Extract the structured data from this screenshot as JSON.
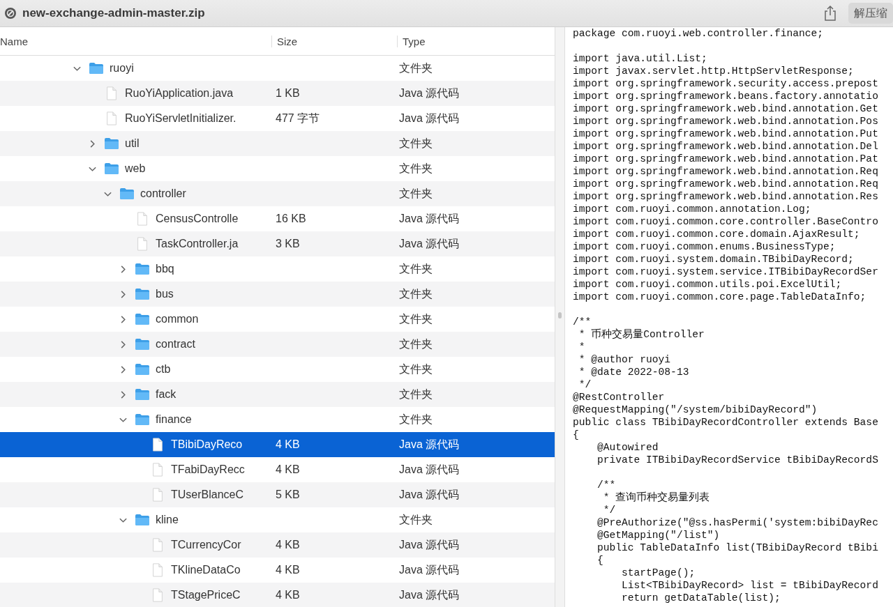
{
  "window": {
    "title": "new-exchange-admin-master.zip"
  },
  "toolbar": {
    "extract_button": "解压缩"
  },
  "columns": [
    "Name",
    "Size",
    "Type"
  ],
  "files": [
    {
      "kind": "folder",
      "name": "ruoyi",
      "type": "文件夹",
      "expanded": true,
      "selected": false,
      "children": [
        {
          "kind": "file",
          "name": "RuoYiApplication.java",
          "size": "1 KB",
          "type": "Java 源代码",
          "selected": false
        },
        {
          "kind": "file",
          "name": "RuoYiServletInitializer.",
          "size": "477 字节",
          "type": "Java 源代码",
          "selected": false
        },
        {
          "kind": "folder",
          "name": "util",
          "type": "文件夹",
          "expanded": false,
          "selected": false
        },
        {
          "kind": "folder",
          "name": "web",
          "type": "文件夹",
          "expanded": true,
          "selected": false,
          "children": [
            {
              "kind": "folder",
              "name": "controller",
              "type": "文件夹",
              "expanded": true,
              "selected": false,
              "children": [
                {
                  "kind": "file",
                  "name": "CensusControlle",
                  "size": "16 KB",
                  "type": "Java 源代码",
                  "selected": false
                },
                {
                  "kind": "file",
                  "name": "TaskController.ja",
                  "size": "3 KB",
                  "type": "Java 源代码",
                  "selected": false
                },
                {
                  "kind": "folder",
                  "name": "bbq",
                  "type": "文件夹",
                  "expanded": false,
                  "selected": false
                },
                {
                  "kind": "folder",
                  "name": "bus",
                  "type": "文件夹",
                  "expanded": false,
                  "selected": false
                },
                {
                  "kind": "folder",
                  "name": "common",
                  "type": "文件夹",
                  "expanded": false,
                  "selected": false
                },
                {
                  "kind": "folder",
                  "name": "contract",
                  "type": "文件夹",
                  "expanded": false,
                  "selected": false
                },
                {
                  "kind": "folder",
                  "name": "ctb",
                  "type": "文件夹",
                  "expanded": false,
                  "selected": false
                },
                {
                  "kind": "folder",
                  "name": "fack",
                  "type": "文件夹",
                  "expanded": false,
                  "selected": false
                },
                {
                  "kind": "folder",
                  "name": "finance",
                  "type": "文件夹",
                  "expanded": true,
                  "selected": false,
                  "children": [
                    {
                      "kind": "file",
                      "name": "TBibiDayReco",
                      "size": "4 KB",
                      "type": "Java 源代码",
                      "selected": true
                    },
                    {
                      "kind": "file",
                      "name": "TFabiDayRecc",
                      "size": "4 KB",
                      "type": "Java 源代码",
                      "selected": false
                    },
                    {
                      "kind": "file",
                      "name": "TUserBlanceC",
                      "size": "5 KB",
                      "type": "Java 源代码",
                      "selected": false
                    }
                  ]
                },
                {
                  "kind": "folder",
                  "name": "kline",
                  "type": "文件夹",
                  "expanded": true,
                  "selected": false,
                  "children": [
                    {
                      "kind": "file",
                      "name": "TCurrencyCor",
                      "size": "4 KB",
                      "type": "Java 源代码",
                      "selected": false
                    },
                    {
                      "kind": "file",
                      "name": "TKlineDataCo",
                      "size": "4 KB",
                      "type": "Java 源代码",
                      "selected": false
                    },
                    {
                      "kind": "file",
                      "name": "TStagePriceC",
                      "size": "4 KB",
                      "type": "Java 源代码",
                      "selected": false
                    }
                  ]
                }
              ]
            }
          ]
        }
      ]
    }
  ],
  "code": {
    "blocks": [
      [
        "package com.ruoyi.web.controller.finance;"
      ],
      [
        "import java.util.List;",
        "import javax.servlet.http.HttpServletResponse;",
        "import org.springframework.security.access.prepost",
        "import org.springframework.beans.factory.annotatio",
        "import org.springframework.web.bind.annotation.Get",
        "import org.springframework.web.bind.annotation.Pos",
        "import org.springframework.web.bind.annotation.Put",
        "import org.springframework.web.bind.annotation.Del",
        "import org.springframework.web.bind.annotation.Pat",
        "import org.springframework.web.bind.annotation.Req",
        "import org.springframework.web.bind.annotation.Req",
        "import org.springframework.web.bind.annotation.Res",
        "import com.ruoyi.common.annotation.Log;",
        "import com.ruoyi.common.core.controller.BaseContro",
        "import com.ruoyi.common.core.domain.AjaxResult;",
        "import com.ruoyi.common.enums.BusinessType;",
        "import com.ruoyi.system.domain.TBibiDayRecord;",
        "import com.ruoyi.system.service.ITBibiDayRecordSer",
        "import com.ruoyi.common.utils.poi.ExcelUtil;",
        "import com.ruoyi.common.core.page.TableDataInfo;"
      ],
      [
        "/**",
        " * 币种交易量Controller",
        " *",
        " * @author ruoyi",
        " * @date 2022-08-13",
        " */",
        "@RestController",
        "@RequestMapping(\"/system/bibiDayRecord\")",
        "public class TBibiDayRecordController extends Base",
        "{",
        "    @Autowired",
        "    private ITBibiDayRecordService tBibiDayRecordS"
      ],
      [
        "    /**",
        "     * 查询币种交易量列表",
        "     */",
        "    @PreAuthorize(\"@ss.hasPermi('system:bibiDayRec",
        "    @GetMapping(\"/list\")",
        "    public TableDataInfo list(TBibiDayRecord tBibi",
        "    {",
        "        startPage();",
        "        List<TBibiDayRecord> list = tBibiDayRecord",
        "        return getDataTable(list);"
      ]
    ]
  }
}
